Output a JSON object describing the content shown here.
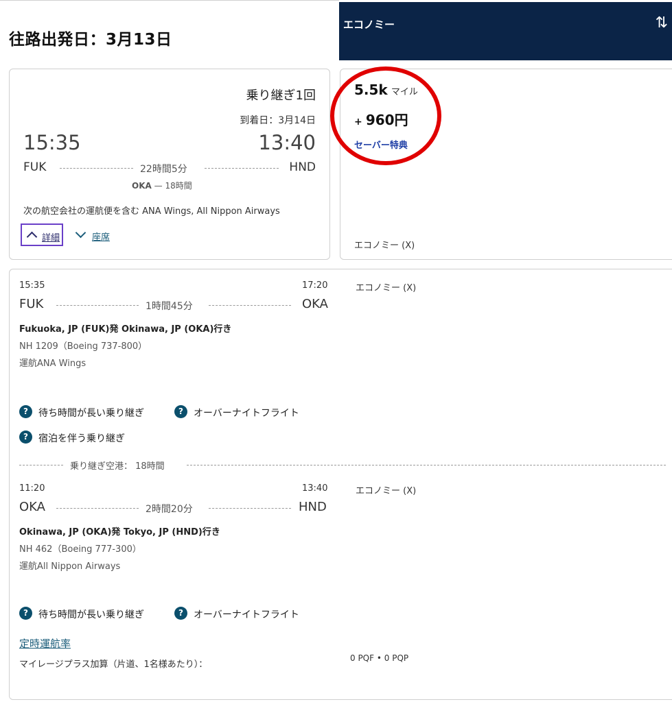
{
  "page_title": "往路出発日：3月13日",
  "cabin_header": {
    "label": "エコノミー",
    "sort_icon": "sort-arrows-icon",
    "bg": "#0b2447"
  },
  "summary": {
    "stops": "乗り継ぎ1回",
    "arrival_date": "到着日：3月14日",
    "depart_time": "15:35",
    "arrive_time": "13:40",
    "origin": "FUK",
    "destination": "HND",
    "duration": "22時間5分",
    "connection_code": "OKA",
    "connection_sep": "—",
    "connection_duration": "18時間",
    "operated_by": "次の航空会社の運航便を含む ANA Wings, All Nippon Airways",
    "details_link": "詳細",
    "seats_link": "座席"
  },
  "price": {
    "miles": "5.5k",
    "miles_unit": "マイル",
    "plus": "+",
    "cash": "960円",
    "fare_type": "セーバー特典",
    "cabin": "エコノミー (X)",
    "highlight_color": "#e00000"
  },
  "segments": [
    {
      "depart_time": "15:35",
      "arrive_time": "17:20",
      "origin": "FUK",
      "destination": "OKA",
      "duration": "1時間45分",
      "cabin": "エコノミー (X)",
      "route": "Fukuoka, JP (FUK)発 Okinawa, JP (OKA)行き",
      "flight": "NH 1209（Boeing 737-800）",
      "operator": "運航ANA Wings",
      "notices": [
        "待ち時間が長い乗り継ぎ",
        "オーバーナイトフライト",
        "宿泊を伴う乗り継ぎ"
      ]
    },
    {
      "depart_time": "11:20",
      "arrive_time": "13:40",
      "origin": "OKA",
      "destination": "HND",
      "duration": "2時間20分",
      "cabin": "エコノミー (X)",
      "route": "Okinawa, JP (OKA)発 Tokyo, JP (HND)行き",
      "flight": "NH 462（Boeing 777-300）",
      "operator": "運航All Nippon Airways",
      "notices": [
        "待ち時間が長い乗り継ぎ",
        "オーバーナイトフライト"
      ]
    }
  ],
  "layover": "乗り継ぎ空港： 18時間",
  "help_glyph": "?",
  "on_time_link": "定時運航率",
  "mileage_label": "マイレージプラス加算（片道、1名様あたり）：",
  "pqf": "0 PQF",
  "pqp_sep": "•",
  "pqp": "0 PQP"
}
